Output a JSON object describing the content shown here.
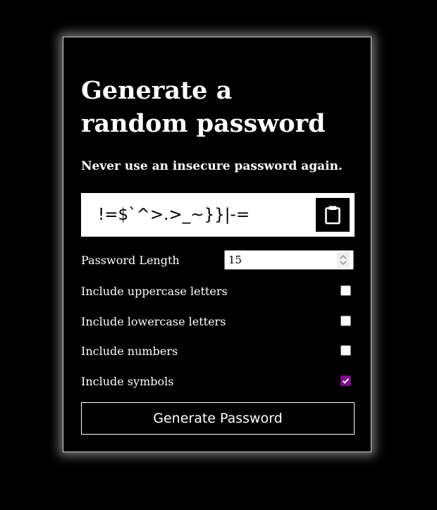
{
  "header": {
    "title": "Generate a random password",
    "subtitle": "Never use an insecure password again."
  },
  "result": {
    "password": "!=$`^>.>_~}}|-=",
    "copy_icon": "clipboard-icon"
  },
  "settings": {
    "length_label": "Password Length",
    "length_value": "15",
    "uppercase": {
      "label": "Include uppercase letters",
      "checked": false
    },
    "lowercase": {
      "label": "Include lowercase letters",
      "checked": false
    },
    "numbers": {
      "label": "Include numbers",
      "checked": false
    },
    "symbols": {
      "label": "Include symbols",
      "checked": true
    }
  },
  "actions": {
    "generate_label": "Generate Password"
  },
  "colors": {
    "background": "#000000",
    "text": "#ffffff",
    "checkbox_accent": "#7d0d86"
  }
}
